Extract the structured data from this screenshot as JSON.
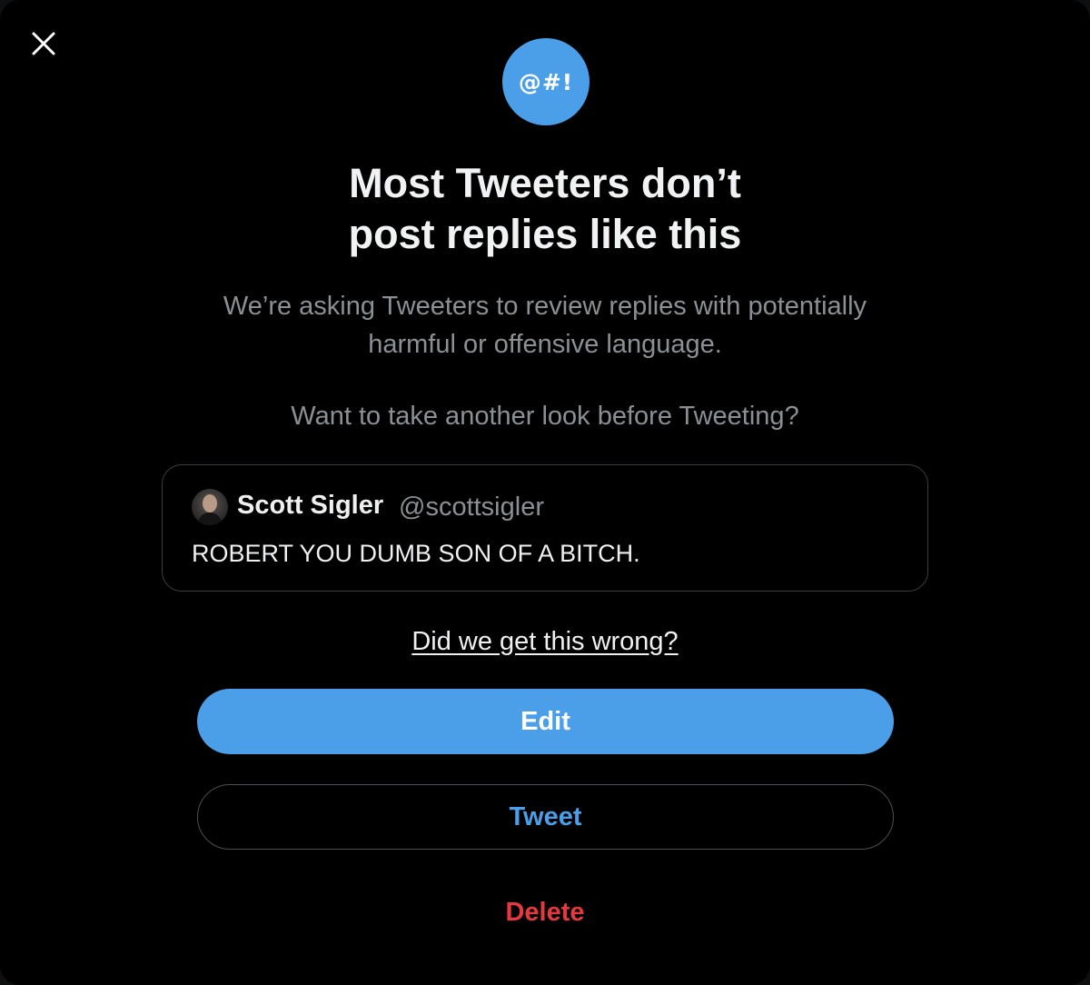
{
  "badge": {
    "text": "@#!",
    "color": "#4b9ee8"
  },
  "title": {
    "line1": "Most Tweeters don’t",
    "line2": "post replies like this"
  },
  "subtitle": {
    "line1": "We’re asking Tweeters to review replies with potentially",
    "line2": "harmful or offensive language."
  },
  "question": "Want to take another look before Tweeting?",
  "tweet": {
    "author_name": "Scott Sigler",
    "author_handle": "@scottsigler",
    "text": "ROBERT YOU DUMB SON OF A BITCH."
  },
  "feedback_link": "Did we get this wrong?",
  "actions": {
    "edit_label": "Edit",
    "tweet_label": "Tweet",
    "delete_label": "Delete"
  },
  "colors": {
    "accent": "#4b9ee8",
    "danger": "#e5393f",
    "background": "#000000"
  },
  "icons": {
    "close": "close-icon",
    "avatar": "avatar"
  }
}
